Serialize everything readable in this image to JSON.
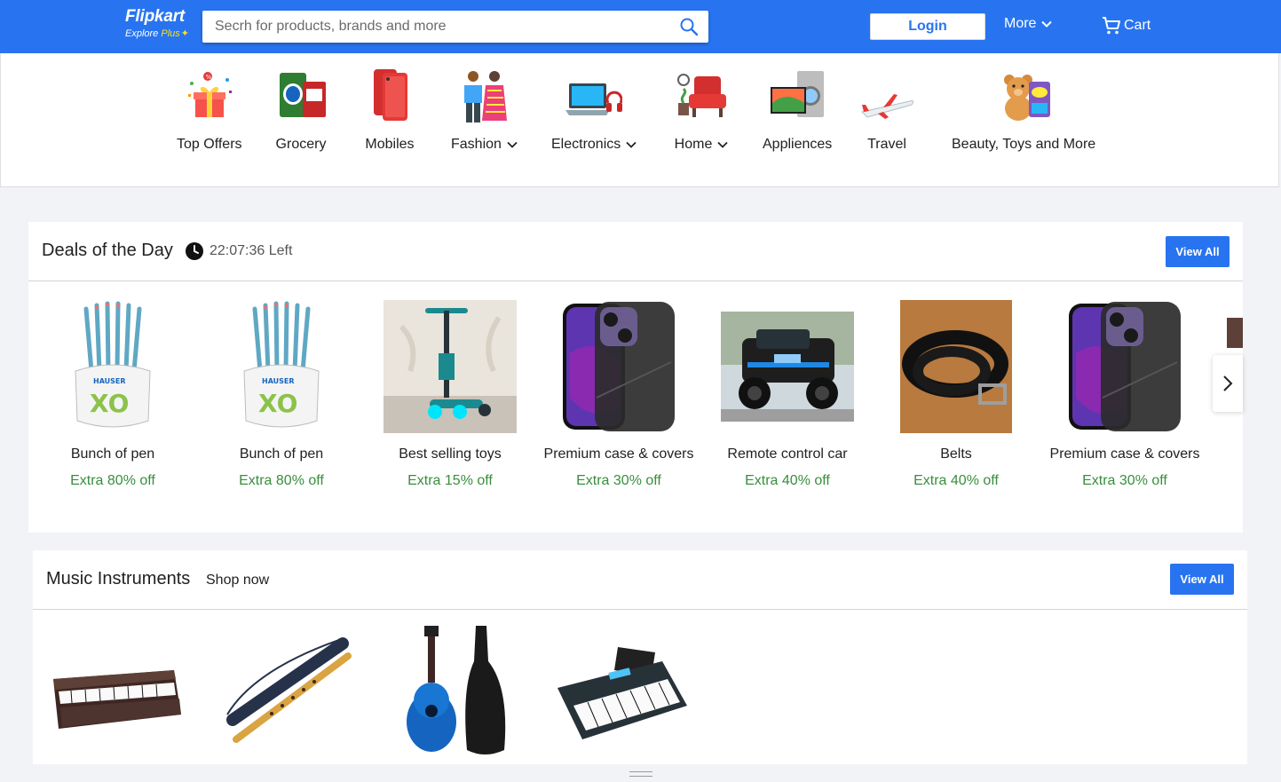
{
  "header": {
    "brand": "Flipkart",
    "tagline_prefix": "Explore",
    "tagline_plus": "Plus",
    "search_placeholder": "Secrh for products, brands and more",
    "login_label": "Login",
    "more_label": "More",
    "cart_label": "Cart",
    "colors": {
      "primary": "#2874f0",
      "plus": "#ffe11b"
    }
  },
  "categories": [
    {
      "label": "Top Offers",
      "icon": "gift-offers-icon",
      "dropdown": false
    },
    {
      "label": "Grocery",
      "icon": "grocery-icon",
      "dropdown": false
    },
    {
      "label": "Mobiles",
      "icon": "mobile-phone-icon",
      "dropdown": false
    },
    {
      "label": "Fashion",
      "icon": "fashion-icon",
      "dropdown": true
    },
    {
      "label": "Electronics",
      "icon": "laptop-icon",
      "dropdown": true
    },
    {
      "label": "Home",
      "icon": "armchair-icon",
      "dropdown": true
    },
    {
      "label": "Appliences",
      "icon": "appliances-icon",
      "dropdown": false
    },
    {
      "label": "Travel",
      "icon": "airplane-icon",
      "dropdown": false
    },
    {
      "label": "Beauty, Toys and More",
      "icon": "teddy-bear-icon",
      "dropdown": false
    }
  ],
  "deals": {
    "title": "Deals of the Day",
    "timer": "22:07:36 Left",
    "view_all": "View All",
    "items": [
      {
        "name": "Bunch of pen",
        "offer": "Extra 80% off"
      },
      {
        "name": "Bunch of pen",
        "offer": "Extra 80% off"
      },
      {
        "name": "Best selling toys",
        "offer": "Extra 15% off"
      },
      {
        "name": "Premium case & covers",
        "offer": "Extra 30% off"
      },
      {
        "name": "Remote control car",
        "offer": "Extra 40% off"
      },
      {
        "name": "Belts",
        "offer": "Extra 40% off"
      },
      {
        "name": "Premium case & covers",
        "offer": "Extra 30% off"
      }
    ],
    "offer_color": "#388e3c"
  },
  "music": {
    "title": "Music Instruments",
    "subtitle": "Shop now",
    "view_all": "View All",
    "items": [
      "harmonium-image",
      "flute-image",
      "guitar-image",
      "keyboard-image"
    ]
  }
}
